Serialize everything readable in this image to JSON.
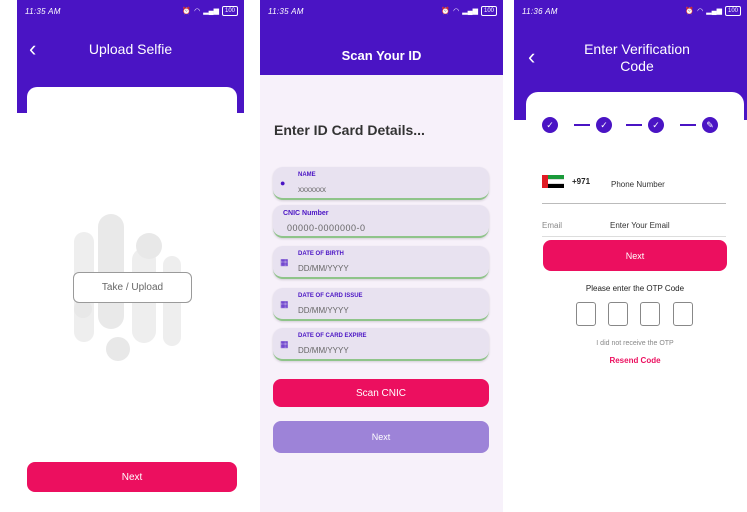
{
  "colors": {
    "brand_purple": "#4a14c4",
    "accent_pink": "#ec0f5f",
    "lavender": "#9d83d8",
    "field_bg": "#e8e2f0"
  },
  "screen1": {
    "status_time": "11:35 AM",
    "title": "Upload Selfie",
    "back_icon": "back-arrow-icon",
    "upload_label": "Take / Upload",
    "next_label": "Next"
  },
  "screen2": {
    "status_time": "11:35 AM",
    "title": "Scan Your ID",
    "heading": "Enter ID Card Details...",
    "fields": [
      {
        "label": "NAME",
        "value": "xxxxxxx",
        "icon": "person-icon"
      },
      {
        "label": "CNIC Number",
        "placeholder": "00000-0000000-0"
      },
      {
        "label": "DATE OF BIRTH",
        "placeholder": "DD/MM/YYYY",
        "icon": "calendar-icon"
      },
      {
        "label": "DATE OF CARD ISSUE",
        "placeholder": "DD/MM/YYYY",
        "icon": "calendar-icon"
      },
      {
        "label": "DATE OF CARD EXPIRE",
        "placeholder": "DD/MM/YYYY",
        "icon": "calendar-icon"
      }
    ],
    "scan_label": "Scan CNIC",
    "next_label": "Next"
  },
  "screen3": {
    "status_time": "11:36 AM",
    "title_line1": "Enter Verification",
    "title_line2": "Code",
    "back_icon": "back-arrow-icon",
    "country_code": "+971",
    "phone_placeholder": "Phone Number",
    "email_label": "Email",
    "email_placeholder": "Enter Your Email",
    "next_label": "Next",
    "otp_prompt": "Please enter the OTP Code",
    "otp_not_received": "I did not receive the OTP",
    "resend_label": "Resend Code"
  }
}
